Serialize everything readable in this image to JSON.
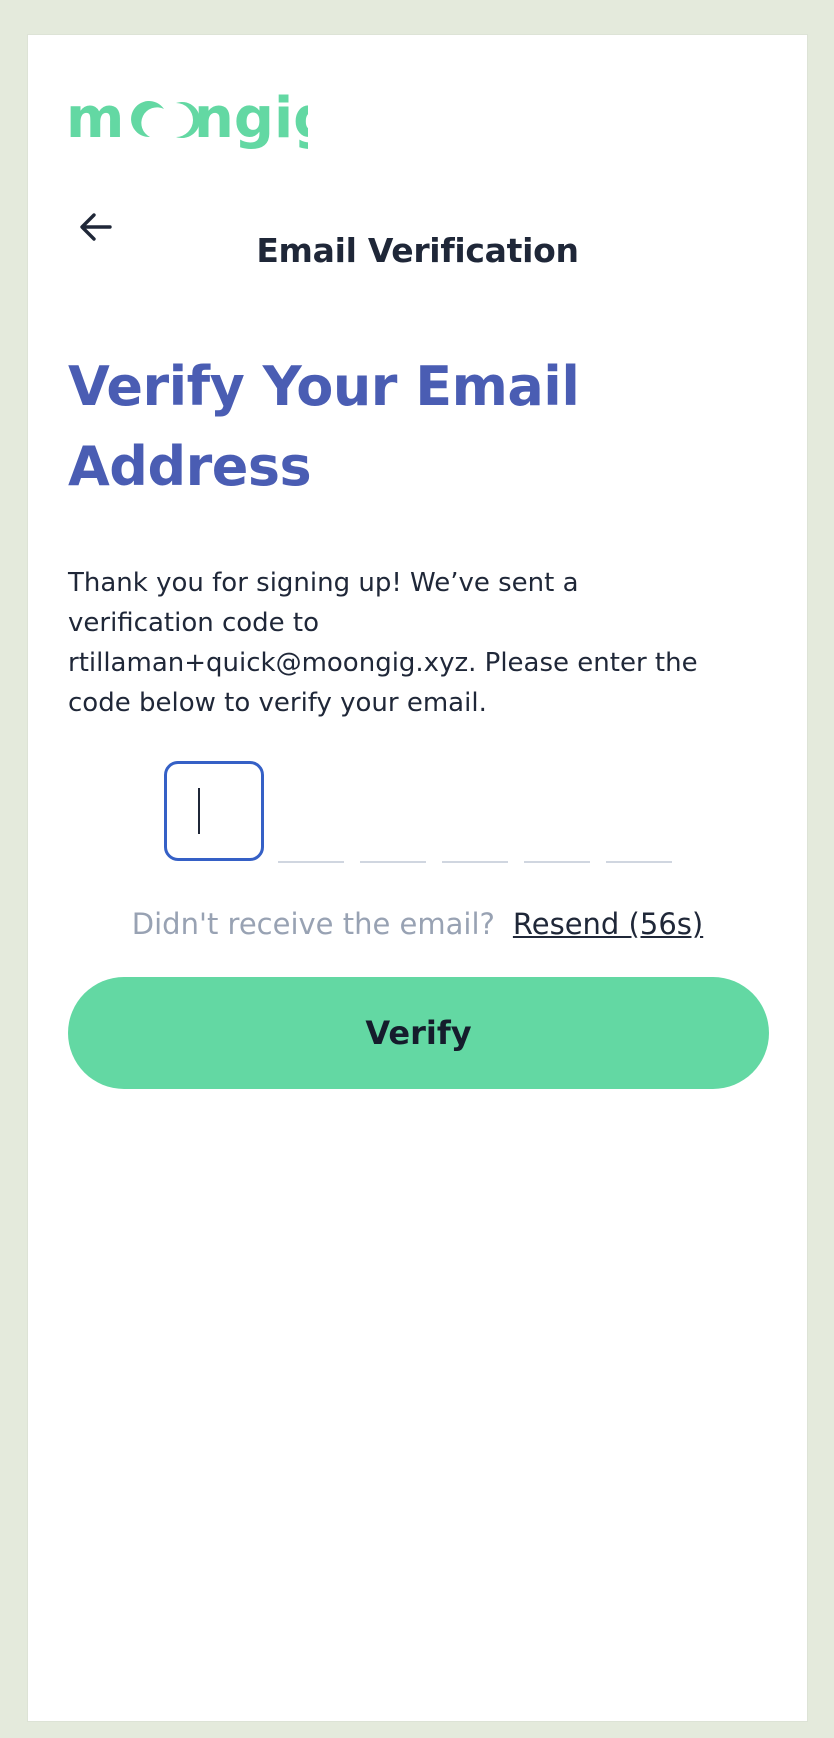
{
  "brand": {
    "logo_text": "moongig",
    "color": "#63d8a3"
  },
  "header": {
    "back_icon": "arrow-left-icon",
    "title": "Email Verification"
  },
  "main": {
    "heading": "Verify Your Email Address",
    "description": "Thank you for signing up! We’ve sent a verification code to rtillaman+quick@moongig.xyz. Please enter the code below to verify your email.",
    "otp": {
      "length": 6,
      "values": [
        "",
        "",
        "",
        "",
        "",
        ""
      ]
    },
    "resend_prompt": "Didn't receive the email?",
    "resend_label": "Resend (56s)",
    "verify_label": "Verify"
  },
  "colors": {
    "heading": "#4a5db3",
    "accent_button": "#63d8a3",
    "text": "#1f2738",
    "muted": "#98a2b3",
    "focus_border": "#3560c6"
  }
}
